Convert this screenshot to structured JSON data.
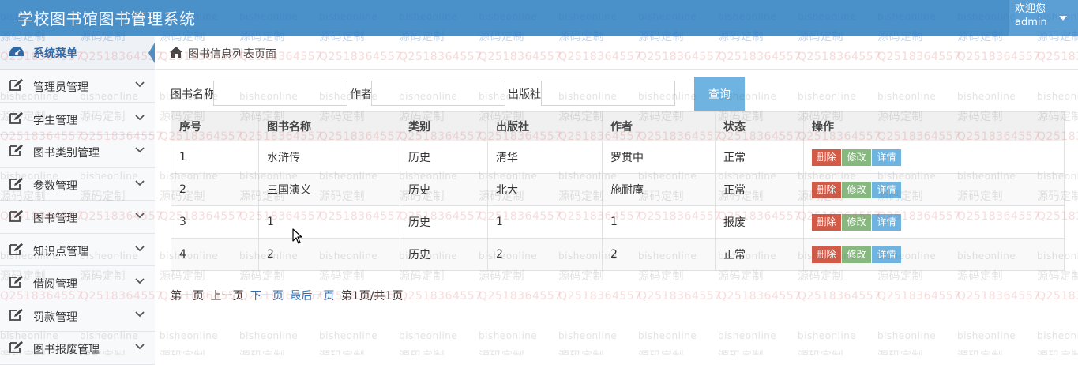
{
  "header": {
    "app_title": "学校图书馆图书管理系统",
    "welcome": "欢迎您",
    "username": "admin"
  },
  "sidebar": {
    "menu_title": "系统菜单",
    "items": [
      {
        "label": "管理员管理",
        "icon": "edit-icon"
      },
      {
        "label": "学生管理",
        "icon": "edit-icon"
      },
      {
        "label": "图书类别管理",
        "icon": "edit-icon"
      },
      {
        "label": "参数管理",
        "icon": "edit-icon"
      },
      {
        "label": "图书管理",
        "icon": "edit-icon"
      },
      {
        "label": "知识点管理",
        "icon": "edit-icon"
      },
      {
        "label": "借阅管理",
        "icon": "edit-icon"
      },
      {
        "label": "罚款管理",
        "icon": "edit-icon"
      },
      {
        "label": "图书报废管理",
        "icon": "edit-icon"
      }
    ]
  },
  "breadcrumb": {
    "label": "图书信息列表页面"
  },
  "filter": {
    "book_name_label": "图书名称",
    "book_name_value": "",
    "author_label": "作者",
    "author_value": "",
    "publisher_label": "出版社",
    "publisher_value": "",
    "query_label": "查询"
  },
  "table": {
    "columns": [
      "序号",
      "图书名称",
      "类别",
      "出版社",
      "作者",
      "状态",
      "操作"
    ],
    "rows": [
      {
        "no": "1",
        "name": "水浒传",
        "category": "历史",
        "publisher": "清华",
        "author": "罗贯中",
        "status": "正常"
      },
      {
        "no": "2",
        "name": "三国演义",
        "category": "历史",
        "publisher": "北大",
        "author": "施耐庵",
        "status": "正常"
      },
      {
        "no": "3",
        "name": "1",
        "category": "历史",
        "publisher": "1",
        "author": "1",
        "status": "报废"
      },
      {
        "no": "4",
        "name": "2",
        "category": "历史",
        "publisher": "2",
        "author": "2",
        "status": "正常"
      }
    ],
    "ops": {
      "delete": "删除",
      "edit": "修改",
      "detail": "详情"
    }
  },
  "pager": {
    "first": "第一页",
    "prev": "上一页",
    "next": "下一页",
    "last": "最后一页",
    "info": "第1页/共1页"
  },
  "watermark": {
    "text_a": "bisheonline",
    "text_b": "源码定制",
    "text_c": "Q2518364557"
  },
  "colors": {
    "header_bg": "#4a90c9",
    "delete": "#d15b47",
    "edit": "#87b87f",
    "detail": "#6fb3e0"
  }
}
